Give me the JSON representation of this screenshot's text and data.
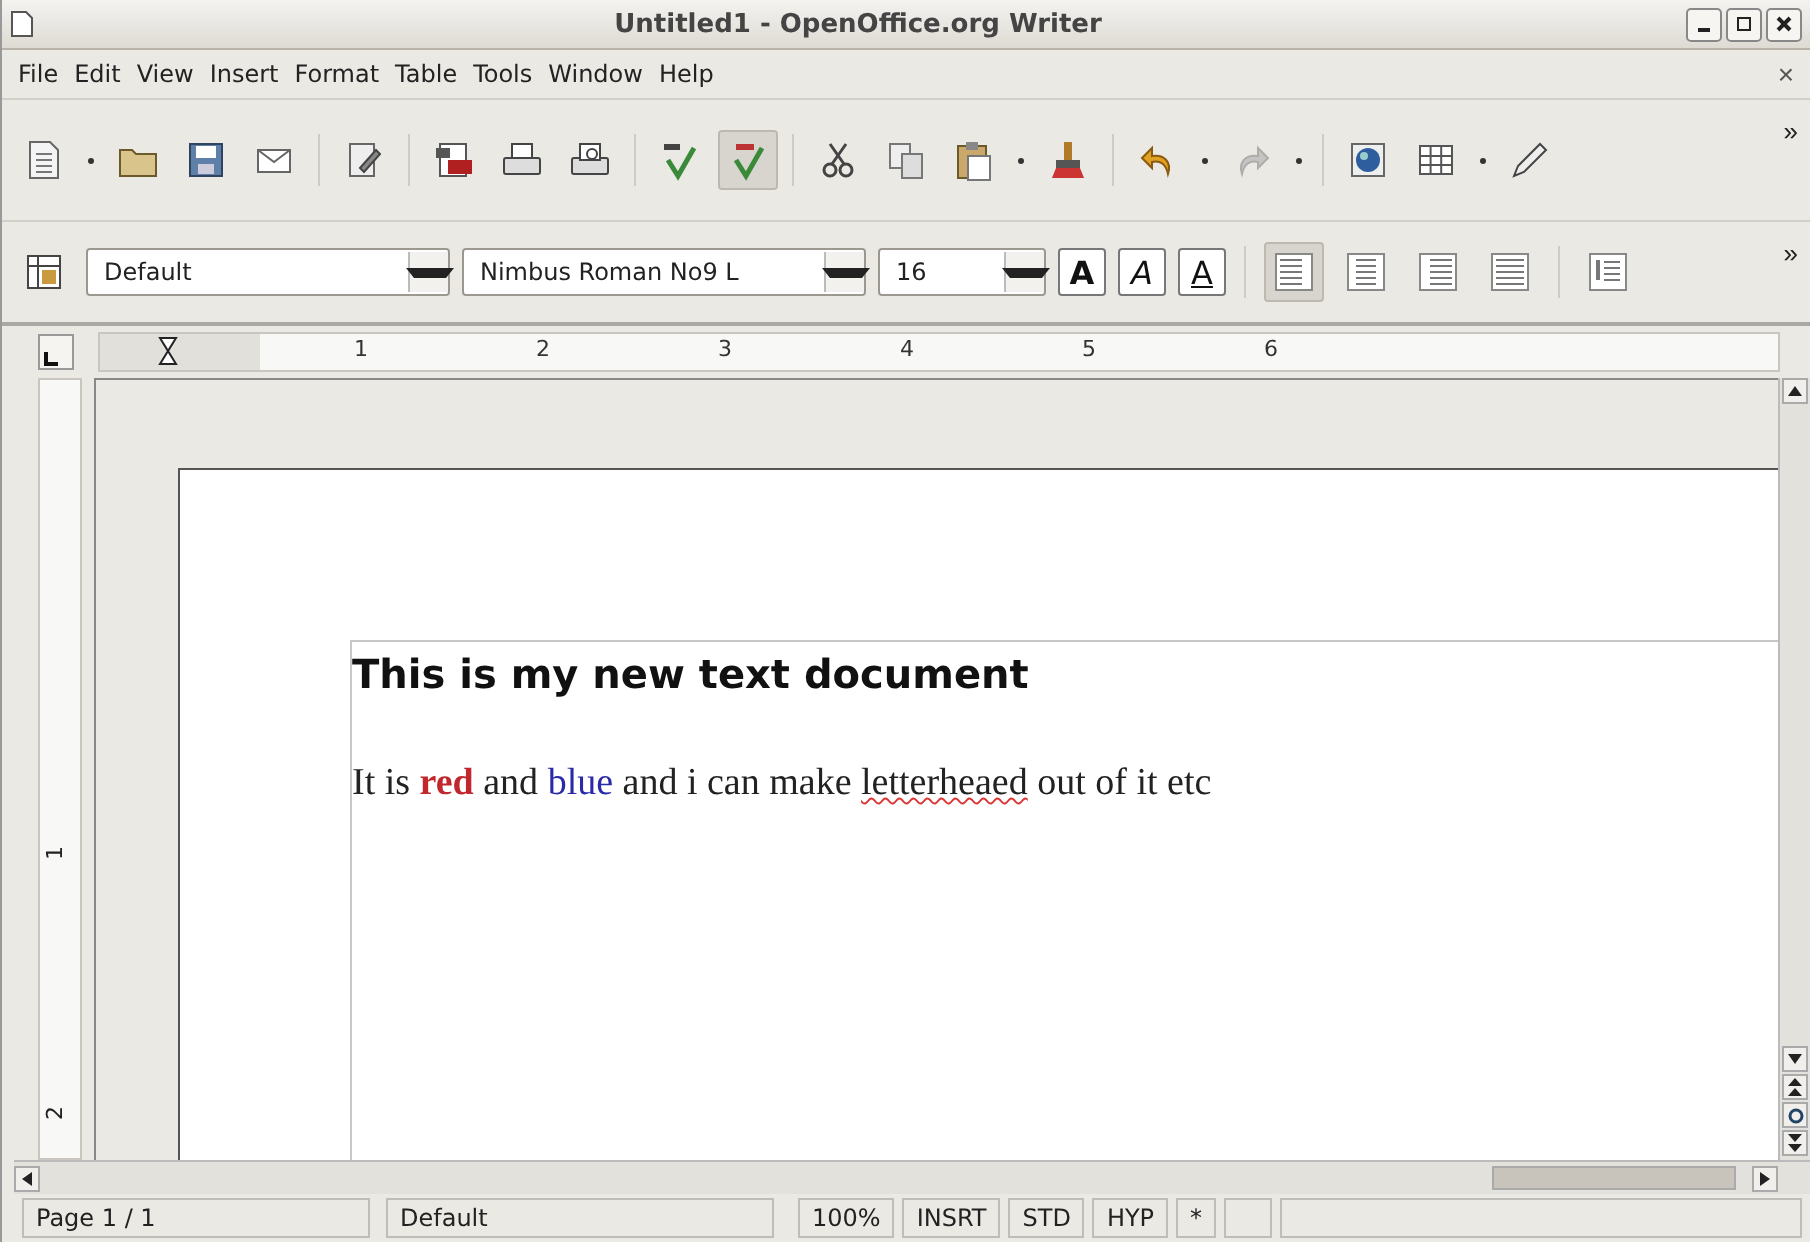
{
  "window": {
    "title": "Untitled1 - OpenOffice.org Writer"
  },
  "menu": [
    "File",
    "Edit",
    "View",
    "Insert",
    "Format",
    "Table",
    "Tools",
    "Window",
    "Help"
  ],
  "close_document": "×",
  "standard_toolbar": {
    "auto_spellcheck_on": true,
    "redo_disabled": true,
    "overflow": "»"
  },
  "formatting_toolbar": {
    "style": "Default",
    "font": "Nimbus Roman No9 L",
    "size": "16",
    "bold": "A",
    "italic": "A",
    "underline": "A",
    "overflow": "»",
    "alignments": [
      {
        "kind": "left",
        "selected": true
      },
      {
        "kind": "center",
        "selected": false
      },
      {
        "kind": "right",
        "selected": false
      },
      {
        "kind": "justify",
        "selected": false
      }
    ]
  },
  "ruler": {
    "labels": [
      "1",
      "2",
      "3",
      "4",
      "5",
      "6"
    ]
  },
  "vertical_ruler": {
    "labels": [
      "1",
      "2"
    ]
  },
  "document": {
    "heading": "This is my new text document",
    "paragraph": [
      {
        "text": "It is "
      },
      {
        "text": "red",
        "color": "#c0282d",
        "bold": true
      },
      {
        "text": " and "
      },
      {
        "text": "blue",
        "color": "#2a2aa8"
      },
      {
        "text": " and i can make "
      },
      {
        "text": "letterheaed",
        "misspelled": true
      },
      {
        "text": " out of it etc"
      }
    ]
  },
  "status_bar": [
    "Page 1 / 1",
    "Default",
    "100%",
    "INSRT",
    "STD",
    "HYP",
    "*"
  ]
}
